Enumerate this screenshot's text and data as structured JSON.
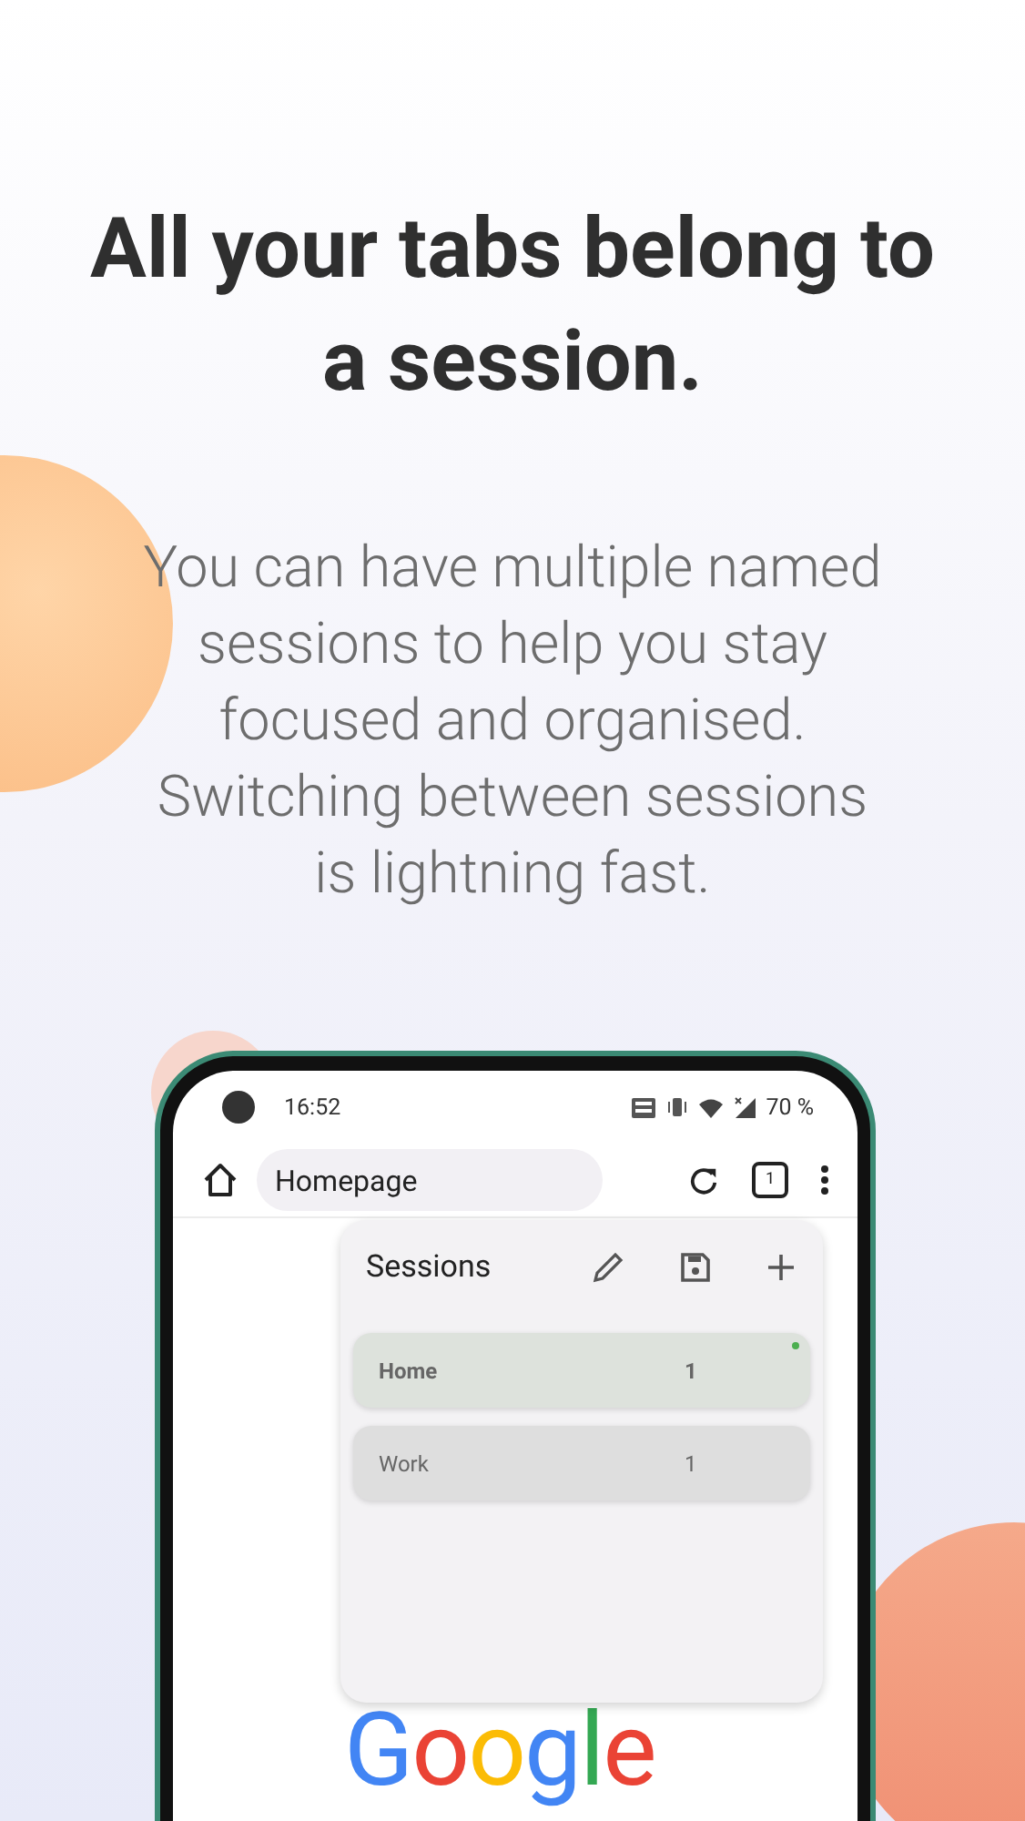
{
  "headline": "All your tabs belong to a session.",
  "description": "You can have multiple named sessions to help you stay focused and organised. Switching between sessions is lightning fast.",
  "phone": {
    "status_bar": {
      "time": "16:52",
      "battery": "70 %"
    },
    "toolbar": {
      "address": "Homepage",
      "tab_count": "1"
    },
    "sessions_panel": {
      "title": "Sessions",
      "sessions": [
        {
          "name": "Home",
          "count": "1",
          "selected": true
        },
        {
          "name": "Work",
          "count": "1",
          "selected": false
        }
      ]
    },
    "logo": "Google"
  }
}
